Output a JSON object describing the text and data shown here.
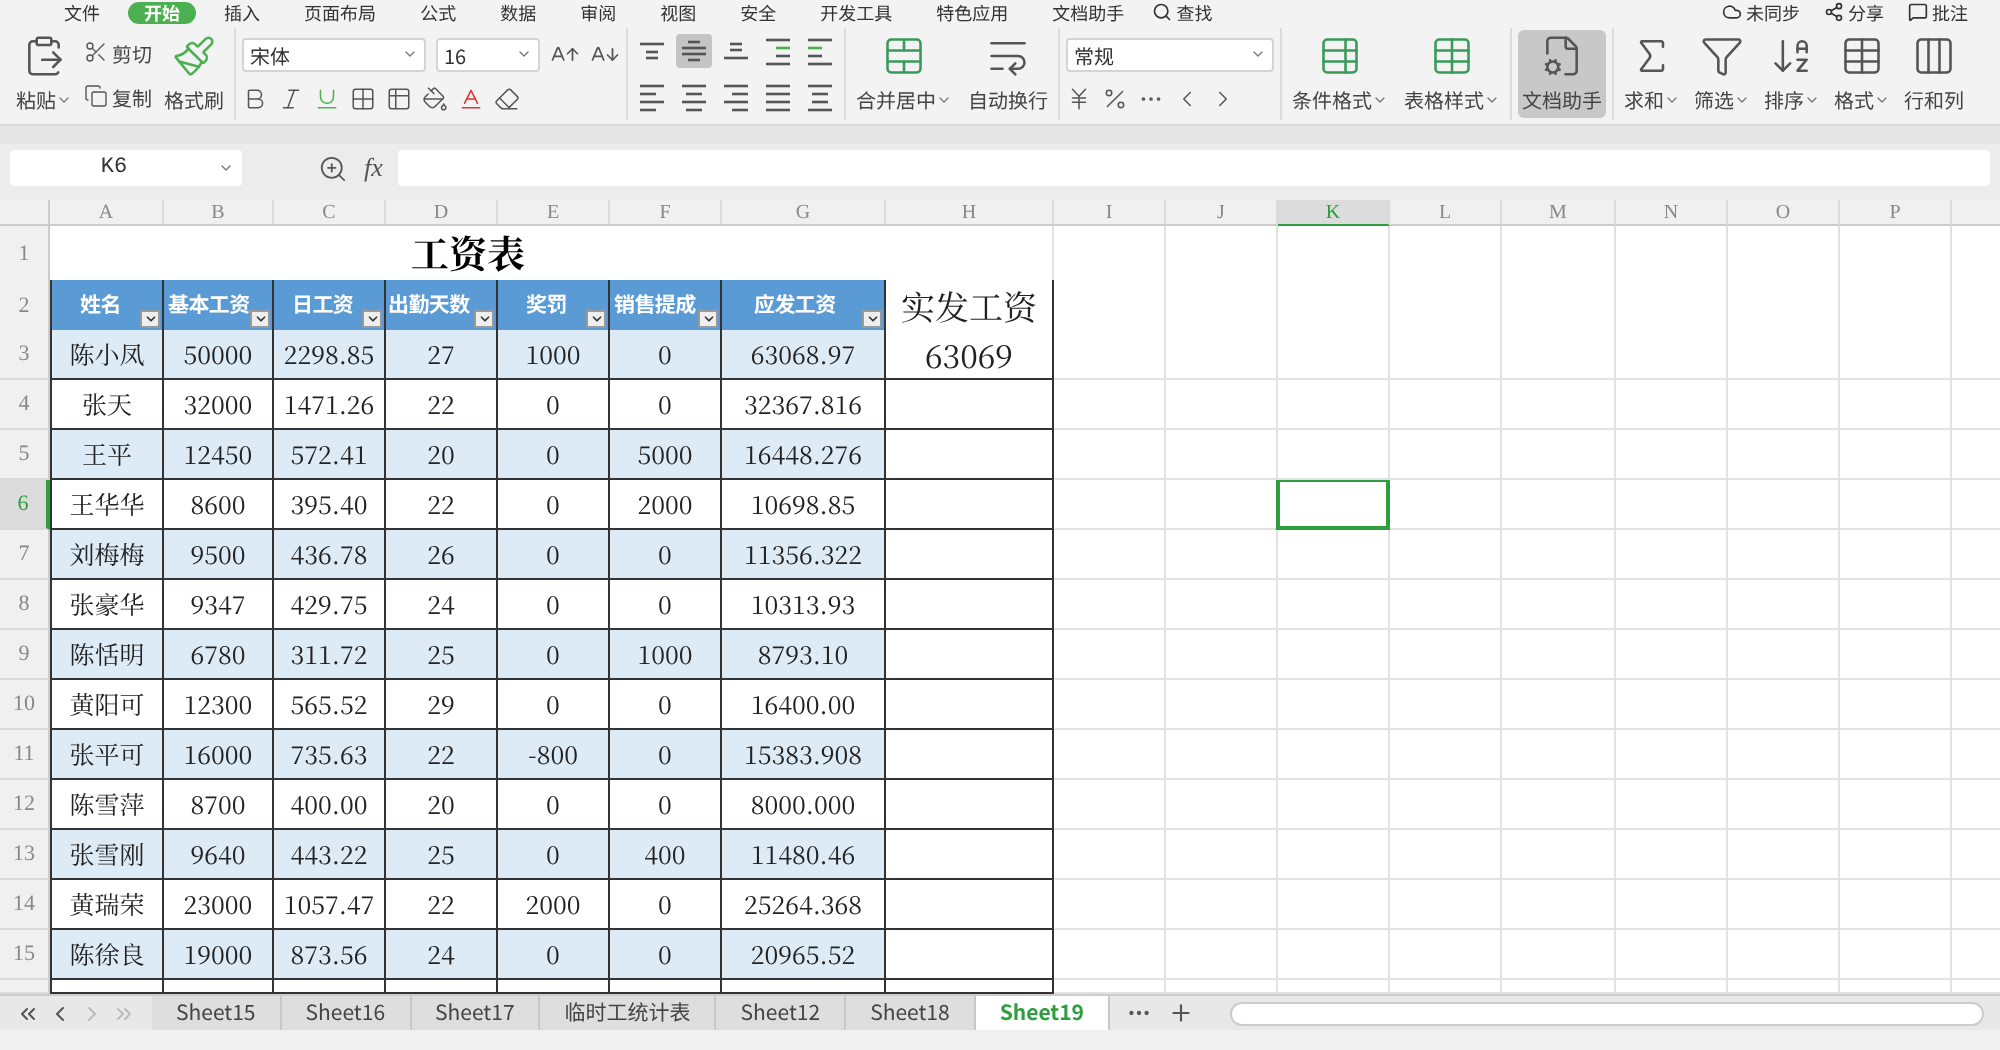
{
  "menu_tabs": [
    {
      "label": "文件",
      "selected": false
    },
    {
      "label": "开始",
      "selected": true
    },
    {
      "label": "插入",
      "selected": false
    },
    {
      "label": "页面布局",
      "selected": false
    },
    {
      "label": "公式",
      "selected": false
    },
    {
      "label": "数据",
      "selected": false
    },
    {
      "label": "审阅",
      "selected": false
    },
    {
      "label": "视图",
      "selected": false
    },
    {
      "label": "安全",
      "selected": false
    },
    {
      "label": "开发工具",
      "selected": false
    },
    {
      "label": "特色应用",
      "selected": false
    },
    {
      "label": "文档助手",
      "selected": false
    }
  ],
  "menu_search": "查找",
  "menu_right": [
    "未同步",
    "分享",
    "批注"
  ],
  "ribbon": {
    "paste": "粘贴",
    "cut": "剪切",
    "copy": "复制",
    "format_painter": "格式刷",
    "font_name": "宋体",
    "font_size": "16",
    "align_buttons": [
      {
        "selected": false
      },
      {
        "selected": true
      },
      {
        "selected": false
      },
      {
        "selected": false
      },
      {
        "selected": false
      },
      {
        "selected": false
      },
      {
        "selected": false
      },
      {
        "selected": false
      },
      {
        "selected": false
      },
      {
        "selected": false
      }
    ],
    "merge_center": "合并居中",
    "wrap_text": "自动换行",
    "number_format": "常规",
    "conditional_format": "条件格式",
    "table_style": "表格样式",
    "doc_assistant": {
      "label": "文档助手",
      "selected": true
    },
    "sum": "求和",
    "filter": "筛选",
    "sort": "排序",
    "format": "格式",
    "rows_columns": "行和列"
  },
  "name_box": "K6",
  "formula_label": "fx",
  "columns": [
    {
      "label": "A",
      "selected": false
    },
    {
      "label": "B",
      "selected": false
    },
    {
      "label": "C",
      "selected": false
    },
    {
      "label": "D",
      "selected": false
    },
    {
      "label": "E",
      "selected": false
    },
    {
      "label": "F",
      "selected": false
    },
    {
      "label": "G",
      "selected": false
    },
    {
      "label": "H",
      "selected": false
    },
    {
      "label": "I",
      "selected": false
    },
    {
      "label": "J",
      "selected": false
    },
    {
      "label": "K",
      "selected": true
    },
    {
      "label": "L",
      "selected": false
    },
    {
      "label": "M",
      "selected": false
    },
    {
      "label": "N",
      "selected": false
    },
    {
      "label": "O",
      "selected": false
    },
    {
      "label": "P",
      "selected": false
    }
  ],
  "sheet": {
    "title": "工资表",
    "headers": [
      "姓名",
      "基本工资",
      "日工资",
      "出勤天数",
      "奖罚",
      "销售提成",
      "应发工资"
    ],
    "extra_header": "实发工资",
    "rows": [
      {
        "num": "3",
        "selected": false,
        "cells": [
          "陈小凤",
          "50000",
          "2298.85",
          "27",
          "1000",
          "0",
          "63068.97"
        ],
        "actual": "63069"
      },
      {
        "num": "4",
        "selected": false,
        "cells": [
          "张天",
          "32000",
          "1471.26",
          "22",
          "0",
          "0",
          "32367.816"
        ]
      },
      {
        "num": "5",
        "selected": false,
        "cells": [
          "王平",
          "12450",
          "572.41",
          "20",
          "0",
          "5000",
          "16448.276"
        ]
      },
      {
        "num": "6",
        "selected": true,
        "cells": [
          "王华华",
          "8600",
          "395.40",
          "22",
          "0",
          "2000",
          "10698.85"
        ]
      },
      {
        "num": "7",
        "selected": false,
        "cells": [
          "刘梅梅",
          "9500",
          "436.78",
          "26",
          "0",
          "0",
          "11356.322"
        ]
      },
      {
        "num": "8",
        "selected": false,
        "cells": [
          "张豪华",
          "9347",
          "429.75",
          "24",
          "0",
          "0",
          "10313.93"
        ]
      },
      {
        "num": "9",
        "selected": false,
        "cells": [
          "陈恬明",
          "6780",
          "311.72",
          "25",
          "0",
          "1000",
          "8793.10"
        ]
      },
      {
        "num": "10",
        "selected": false,
        "cells": [
          "黄阳可",
          "12300",
          "565.52",
          "29",
          "0",
          "0",
          "16400.00"
        ]
      },
      {
        "num": "11",
        "selected": false,
        "cells": [
          "张平可",
          "16000",
          "735.63",
          "22",
          "-800",
          "0",
          "15383.908"
        ]
      },
      {
        "num": "12",
        "selected": false,
        "cells": [
          "陈雪萍",
          "8700",
          "400.00",
          "20",
          "0",
          "0",
          "8000.000"
        ]
      },
      {
        "num": "13",
        "selected": false,
        "cells": [
          "张雪刚",
          "9640",
          "443.22",
          "25",
          "0",
          "400",
          "11480.46"
        ]
      },
      {
        "num": "14",
        "selected": false,
        "cells": [
          "黄瑞荣",
          "23000",
          "1057.47",
          "22",
          "2000",
          "0",
          "25264.368"
        ]
      },
      {
        "num": "15",
        "selected": false,
        "cells": [
          "陈徐良",
          "19000",
          "873.56",
          "24",
          "0",
          "0",
          "20965.52"
        ]
      }
    ],
    "title_row_num": "1",
    "header_row_num": "2"
  },
  "sheet_tabs": [
    {
      "label": "Sheet15",
      "selected": false
    },
    {
      "label": "Sheet16",
      "selected": false
    },
    {
      "label": "Sheet17",
      "selected": false
    },
    {
      "label": "临时工统计表",
      "selected": false
    },
    {
      "label": "Sheet12",
      "selected": false
    },
    {
      "label": "Sheet18",
      "selected": false
    },
    {
      "label": "Sheet19",
      "selected": true
    }
  ]
}
